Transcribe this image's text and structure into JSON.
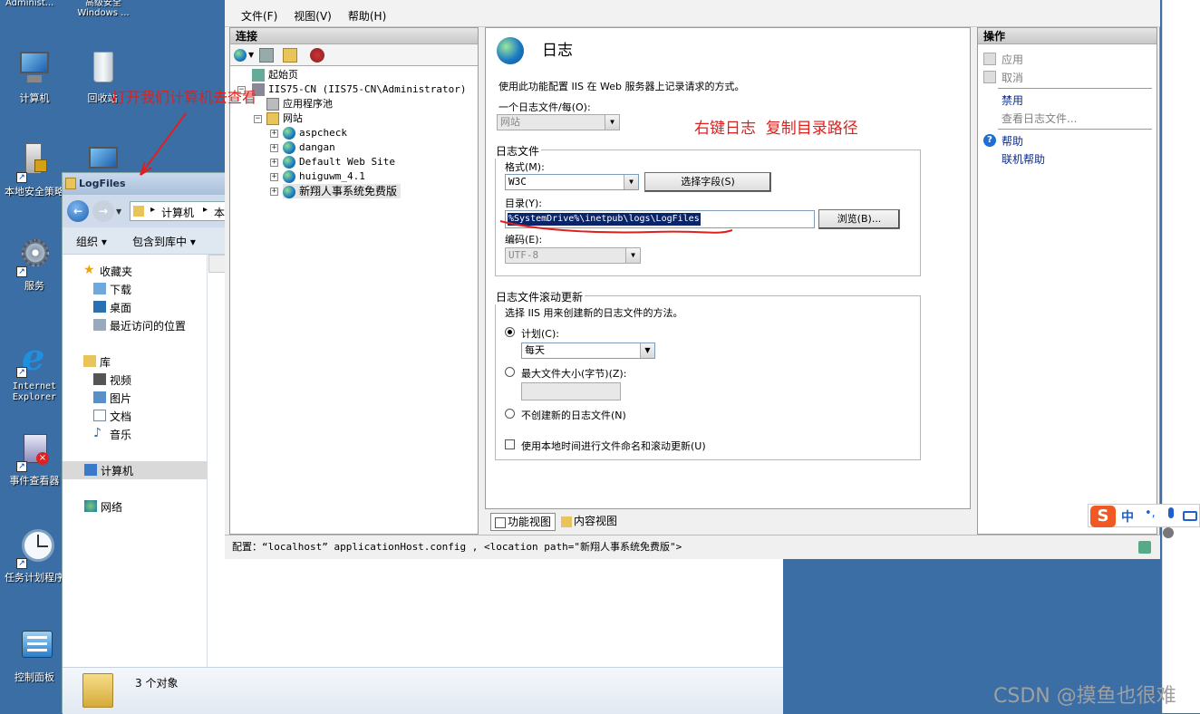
{
  "desktop": {
    "top_icons": [
      {
        "label": "Administ..."
      },
      {
        "label": "高级安全\nWindows ..."
      }
    ],
    "icons": [
      {
        "label": "计算机",
        "icon": "computer-icon"
      },
      {
        "label": "回收站",
        "icon": "recycle-bin-icon"
      },
      {
        "label": "本地安全策略",
        "icon": "security-policy-icon"
      },
      {
        "label": "服务",
        "icon": "services-gear-icon"
      },
      {
        "label": "Internet Explorer",
        "icon": "internet-explorer-icon"
      },
      {
        "label": "事件查看器",
        "icon": "event-viewer-icon"
      },
      {
        "label": "任务计划程序",
        "icon": "task-scheduler-clock-icon"
      },
      {
        "label": "控制面板",
        "icon": "control-panel-icon"
      }
    ],
    "annotation_open_computer": "打开我们计算机去查看",
    "annotation_copy_path": "右键日志  复制目录路径"
  },
  "iis": {
    "menu": [
      "文件(F)",
      "视图(V)",
      "帮助(H)"
    ],
    "connections_title": "连接",
    "tree": [
      {
        "label": "起始页",
        "level": 0,
        "icon": "start-page-icon"
      },
      {
        "label": "IIS75-CN (IIS75-CN\\Administrator)",
        "level": 0,
        "icon": "server-icon"
      },
      {
        "label": "应用程序池",
        "level": 1,
        "icon": "app-pool-icon"
      },
      {
        "label": "网站",
        "level": 1,
        "icon": "sites-folder-icon"
      },
      {
        "label": "aspcheck",
        "level": 2,
        "icon": "globe-icon"
      },
      {
        "label": "dangan",
        "level": 2,
        "icon": "globe-icon"
      },
      {
        "label": "Default Web Site",
        "level": 2,
        "icon": "globe-icon"
      },
      {
        "label": "huiguwm_4.1",
        "level": 2,
        "icon": "globe-icon"
      },
      {
        "label": "新翔人事系统免费版",
        "level": 2,
        "icon": "globe-icon",
        "selected": true
      }
    ],
    "page_title": "日志",
    "description": "使用此功能配置 IIS 在 Web 服务器上记录请求的方式。",
    "one_log_per_label": "一个日志文件/每(O):",
    "one_log_per_value": "网站",
    "log_file_group": "日志文件",
    "format_label": "格式(M):",
    "format_value": "W3C",
    "select_fields_button": "选择字段(S)",
    "directory_label": "目录(Y):",
    "directory_value": "%SystemDrive%\\inetpub\\logs\\LogFiles",
    "browse_button": "浏览(B)...",
    "encoding_label": "编码(E):",
    "encoding_value": "UTF-8",
    "rollover_group": "日志文件滚动更新",
    "rollover_description": "选择 IIS 用来创建新的日志文件的方法。",
    "schedule_label": "计划(C):",
    "schedule_value": "每天",
    "max_size_label": "最大文件大小(字节)(Z):",
    "no_new_file_label": "不创建新的日志文件(N)",
    "local_time_label": "使用本地时间进行文件命名和滚动更新(U)",
    "tab_features": "功能视图",
    "tab_content": "内容视图",
    "actions_title": "操作",
    "actions": {
      "apply": "应用",
      "cancel": "取消",
      "disable": "禁用",
      "view_logs": "查看日志文件...",
      "help": "帮助",
      "online_help": "联机帮助"
    },
    "status_text": "配置：“localhost” applicationHost.config , <location path=\"新翔人事系统免费版\">"
  },
  "explorer": {
    "title": "LogFiles",
    "address_parts": [
      "计算机",
      "本"
    ],
    "organize": "组织 ▾",
    "include_library": "包含到库中 ▾",
    "nav": {
      "favorites": "收藏夹",
      "downloads": "下载",
      "desktop": "桌面",
      "recent": "最近访问的位置",
      "libraries": "库",
      "videos": "视频",
      "pictures": "图片",
      "documents": "文档",
      "music": "音乐",
      "computer": "计算机",
      "network": "网络"
    },
    "status_count": "3 个对象"
  },
  "ime": {
    "lang": "中"
  },
  "watermark": "CSDN @摸鱼也很难",
  "colors": {
    "desktop": "#3a6ea5",
    "annotation_red": "#e0201c",
    "selection_blue": "#0a246a"
  }
}
